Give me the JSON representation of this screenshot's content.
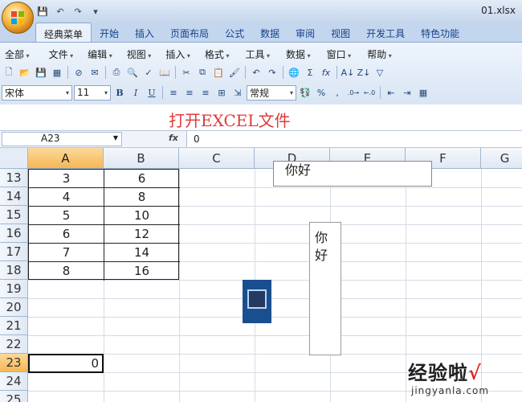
{
  "window": {
    "title": "01.xlsx"
  },
  "tabs": [
    "经典菜单",
    "开始",
    "插入",
    "页面布局",
    "公式",
    "数据",
    "审阅",
    "视图",
    "开发工具",
    "特色功能"
  ],
  "menus": [
    "全部",
    "文件",
    "编辑",
    "视图",
    "插入",
    "格式",
    "工具",
    "数据",
    "窗口",
    "帮助"
  ],
  "toolbar": {
    "font_name": "宋体",
    "font_size": "11",
    "number_format": "常规",
    "bold": "B",
    "italic": "I",
    "underline": "U"
  },
  "banner": {
    "text": "打开EXCEL文件"
  },
  "formula_bar": {
    "name_box": "A23",
    "fx": "fx",
    "content": "0"
  },
  "columns": [
    "A",
    "B",
    "C",
    "D",
    "E",
    "F",
    "G"
  ],
  "rows": [
    "13",
    "14",
    "15",
    "16",
    "17",
    "18",
    "19",
    "20",
    "21",
    "22",
    "23",
    "24",
    "25"
  ],
  "table": [
    [
      "3",
      "6"
    ],
    [
      "4",
      "8"
    ],
    [
      "5",
      "10"
    ],
    [
      "6",
      "12"
    ],
    [
      "7",
      "14"
    ],
    [
      "8",
      "16"
    ]
  ],
  "active_cell": {
    "ref": "A23",
    "value": "0"
  },
  "textboxes": {
    "horizontal": "你好",
    "vertical_line1": "你",
    "vertical_line2": "好"
  },
  "watermark": {
    "line1": "经验啦",
    "check": "√",
    "line2": "jingyanla.com"
  },
  "colors": {
    "accent": "#f6b755",
    "banner_text": "#e03a3a",
    "ribbon": "#c4d6ee"
  }
}
